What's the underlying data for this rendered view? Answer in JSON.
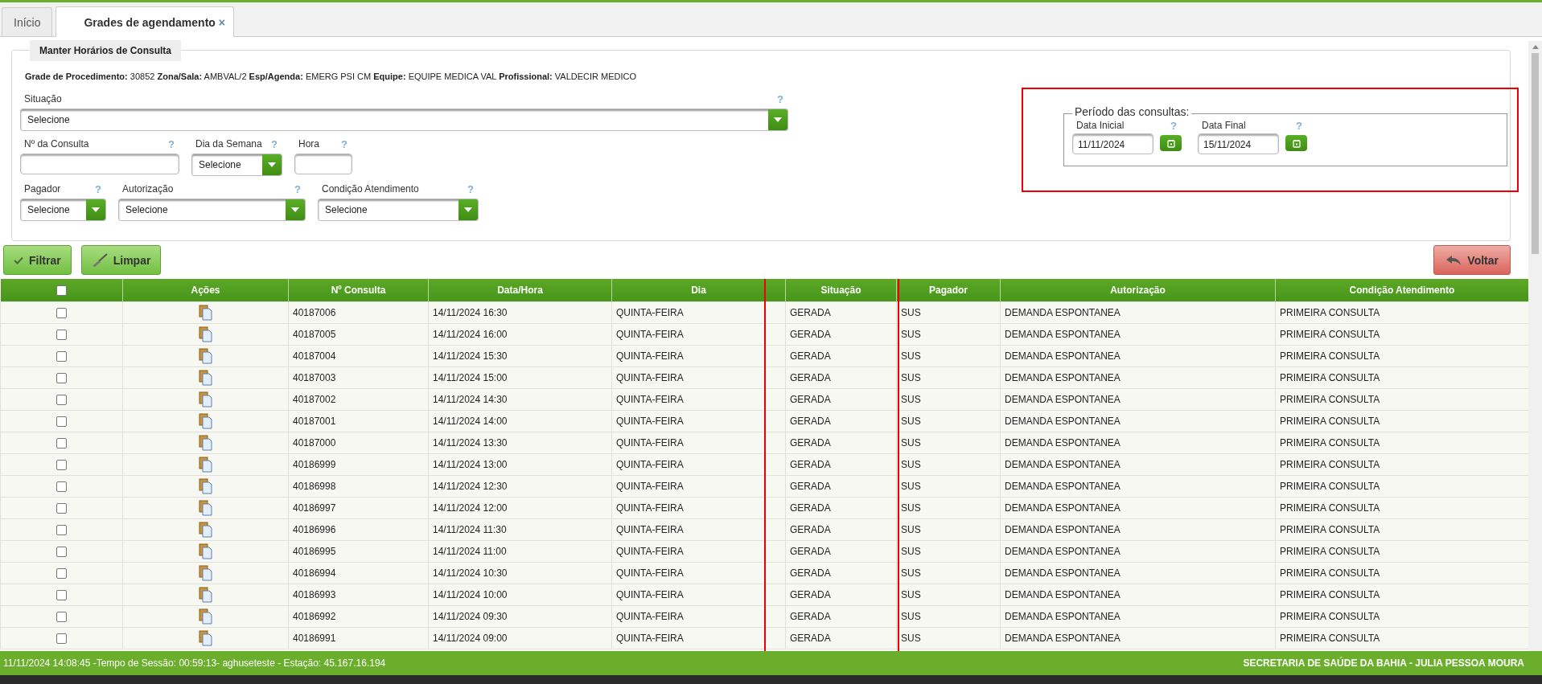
{
  "tabs": [
    {
      "label": "Início",
      "selected": false
    },
    {
      "label": "Grades de agendamento",
      "selected": true,
      "close": "×"
    }
  ],
  "panel": {
    "title": "Manter Horários de Consulta",
    "info": "**Grade de Procedimento:** 30852 **Zona/Sala:** AMBVAL/2 **Esp/Agenda:** EMERG PSI CM **Equipe:** EQUIPE MEDICA VAL **Profissional:** VALDECIR MEDICO",
    "filter_rows": [
      [
        {
          "kind": "select",
          "label": "Situação",
          "help": "?",
          "value": "Selecione"
        }
      ],
      [
        {
          "kind": "input",
          "label": "Nº da Consulta",
          "help": "?"
        },
        {
          "kind": "select",
          "label": "Dia da Semana",
          "help": "?",
          "value": "Selecione"
        },
        {
          "kind": "input",
          "label": "Hora",
          "help": "?"
        }
      ],
      [
        {
          "kind": "select",
          "label": "Pagador",
          "help": "?",
          "value": "Selecione"
        },
        {
          "kind": "select",
          "label": "Autorização",
          "help": "?",
          "value": "Selecione"
        },
        {
          "kind": "select",
          "label": "Condição Atendimento",
          "help": "?",
          "value": "Selecione"
        }
      ]
    ],
    "period": {
      "legend": "Período das consultas:",
      "fields": [
        {
          "label": "Data Inicial",
          "help": "?",
          "value": "11/11/2024"
        },
        {
          "label": "Data Final",
          "help": "?",
          "value": "15/11/2024"
        }
      ]
    }
  },
  "buttons": [
    {
      "kind": "filter",
      "label": "Filtrar"
    },
    {
      "kind": "clear",
      "label": "Limpar"
    },
    {
      "kind": "back",
      "label": "Voltar"
    }
  ],
  "table": {
    "header_checked": false,
    "columns": [
      "",
      "Ações",
      "Nº Consulta",
      "Data/Hora",
      "Dia",
      "Situação",
      "Pagador",
      "Autorização",
      "Condição Atendimento"
    ],
    "rows": [
      {
        "checked": false,
        "cells": [
          "",
          "",
          "40187006",
          "14/11/2024 16:30",
          "QUINTA-FEIRA",
          "GERADA",
          "SUS",
          "DEMANDA ESPONTANEA",
          "PRIMEIRA CONSULTA"
        ]
      },
      {
        "checked": false,
        "cells": [
          "",
          "",
          "40187005",
          "14/11/2024 16:00",
          "QUINTA-FEIRA",
          "GERADA",
          "SUS",
          "DEMANDA ESPONTANEA",
          "PRIMEIRA CONSULTA"
        ]
      },
      {
        "checked": false,
        "cells": [
          "",
          "",
          "40187004",
          "14/11/2024 15:30",
          "QUINTA-FEIRA",
          "GERADA",
          "SUS",
          "DEMANDA ESPONTANEA",
          "PRIMEIRA CONSULTA"
        ]
      },
      {
        "checked": false,
        "cells": [
          "",
          "",
          "40187003",
          "14/11/2024 15:00",
          "QUINTA-FEIRA",
          "GERADA",
          "SUS",
          "DEMANDA ESPONTANEA",
          "PRIMEIRA CONSULTA"
        ]
      },
      {
        "checked": false,
        "cells": [
          "",
          "",
          "40187002",
          "14/11/2024 14:30",
          "QUINTA-FEIRA",
          "GERADA",
          "SUS",
          "DEMANDA ESPONTANEA",
          "PRIMEIRA CONSULTA"
        ]
      },
      {
        "checked": false,
        "cells": [
          "",
          "",
          "40187001",
          "14/11/2024 14:00",
          "QUINTA-FEIRA",
          "GERADA",
          "SUS",
          "DEMANDA ESPONTANEA",
          "PRIMEIRA CONSULTA"
        ]
      },
      {
        "checked": false,
        "cells": [
          "",
          "",
          "40187000",
          "14/11/2024 13:30",
          "QUINTA-FEIRA",
          "GERADA",
          "SUS",
          "DEMANDA ESPONTANEA",
          "PRIMEIRA CONSULTA"
        ]
      },
      {
        "checked": false,
        "cells": [
          "",
          "",
          "40186999",
          "14/11/2024 13:00",
          "QUINTA-FEIRA",
          "GERADA",
          "SUS",
          "DEMANDA ESPONTANEA",
          "PRIMEIRA CONSULTA"
        ]
      },
      {
        "checked": false,
        "cells": [
          "",
          "",
          "40186998",
          "14/11/2024 12:30",
          "QUINTA-FEIRA",
          "GERADA",
          "SUS",
          "DEMANDA ESPONTANEA",
          "PRIMEIRA CONSULTA"
        ]
      },
      {
        "checked": false,
        "cells": [
          "",
          "",
          "40186997",
          "14/11/2024 12:00",
          "QUINTA-FEIRA",
          "GERADA",
          "SUS",
          "DEMANDA ESPONTANEA",
          "PRIMEIRA CONSULTA"
        ]
      },
      {
        "checked": false,
        "cells": [
          "",
          "",
          "40186996",
          "14/11/2024 11:30",
          "QUINTA-FEIRA",
          "GERADA",
          "SUS",
          "DEMANDA ESPONTANEA",
          "PRIMEIRA CONSULTA"
        ]
      },
      {
        "checked": false,
        "cells": [
          "",
          "",
          "40186995",
          "14/11/2024 11:00",
          "QUINTA-FEIRA",
          "GERADA",
          "SUS",
          "DEMANDA ESPONTANEA",
          "PRIMEIRA CONSULTA"
        ]
      },
      {
        "checked": false,
        "cells": [
          "",
          "",
          "40186994",
          "14/11/2024 10:30",
          "QUINTA-FEIRA",
          "GERADA",
          "SUS",
          "DEMANDA ESPONTANEA",
          "PRIMEIRA CONSULTA"
        ]
      },
      {
        "checked": false,
        "cells": [
          "",
          "",
          "40186993",
          "14/11/2024 10:00",
          "QUINTA-FEIRA",
          "GERADA",
          "SUS",
          "DEMANDA ESPONTANEA",
          "PRIMEIRA CONSULTA"
        ]
      },
      {
        "checked": false,
        "cells": [
          "",
          "",
          "40186992",
          "14/11/2024 09:30",
          "QUINTA-FEIRA",
          "GERADA",
          "SUS",
          "DEMANDA ESPONTANEA",
          "PRIMEIRA CONSULTA"
        ]
      },
      {
        "checked": false,
        "cells": [
          "",
          "",
          "40186991",
          "14/11/2024 09:00",
          "QUINTA-FEIRA",
          "GERADA",
          "SUS",
          "DEMANDA ESPONTANEA",
          "PRIMEIRA CONSULTA"
        ]
      }
    ]
  },
  "status_bar": {
    "left": "11/11/2024 14:08:45 -Tempo de Sessão: 00:59:13- aghuseteste - Estação: 45.167.16.194",
    "right": "SECRETARIA DE SAÚDE DA BAHIA - JULIA PESSOA MOURA"
  }
}
